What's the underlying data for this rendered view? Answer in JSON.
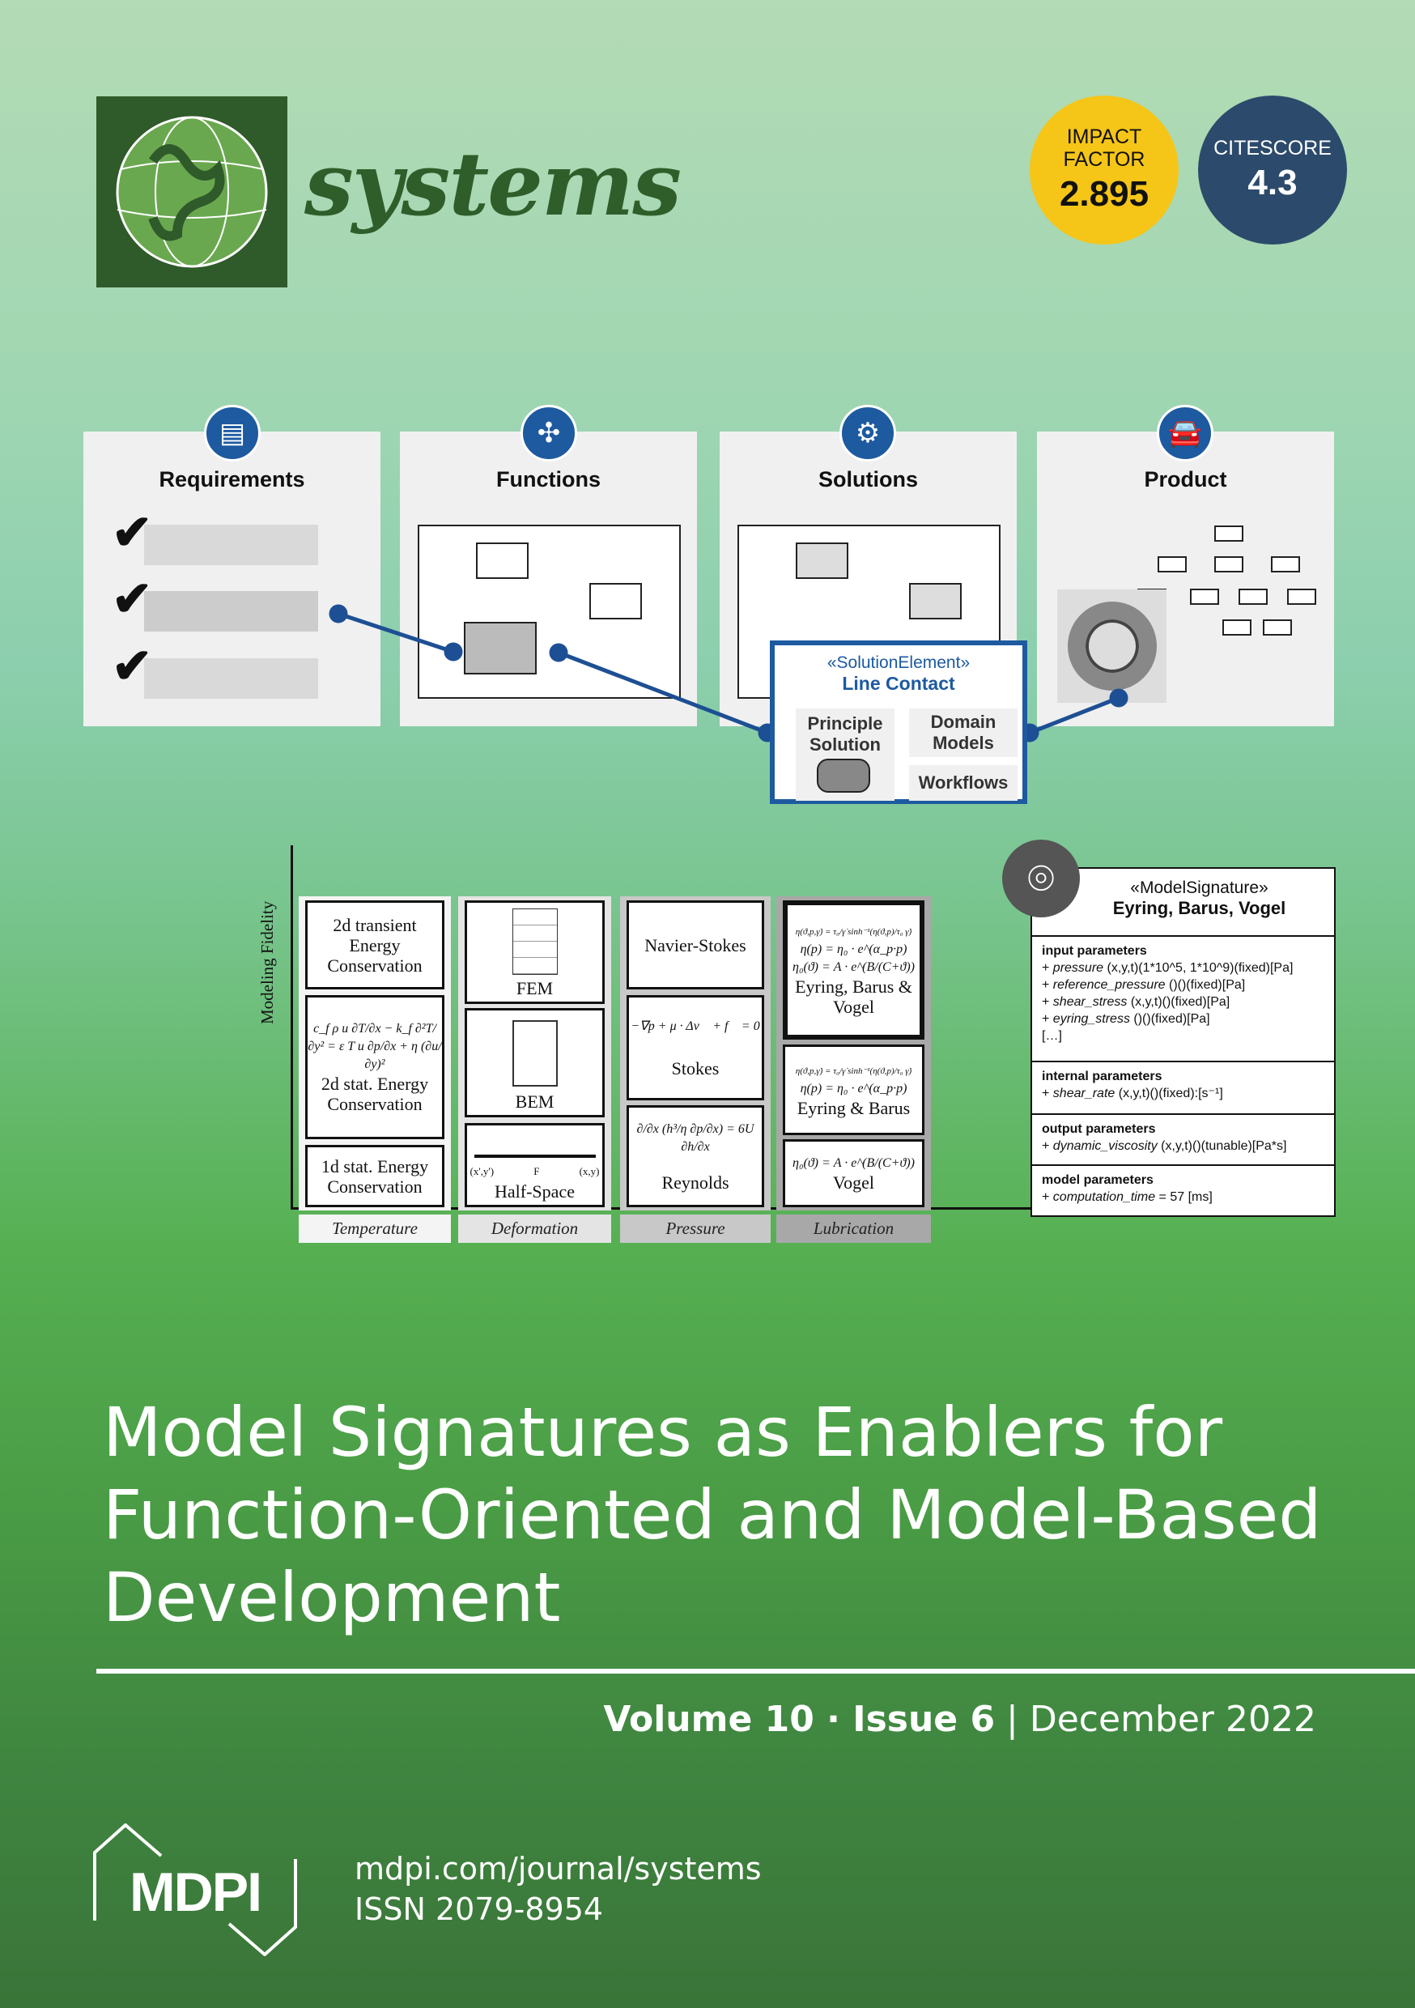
{
  "journal": {
    "name": "systems",
    "logo_icon": "globe-icon"
  },
  "badges": {
    "impact": {
      "label_line1": "IMPACT",
      "label_line2": "FACTOR",
      "value": "2.895",
      "color": "#f5c518"
    },
    "citescore": {
      "label": "CITESCORE",
      "value": "4.3",
      "color": "#2c4a6b"
    }
  },
  "panels": [
    {
      "title": "Requirements",
      "icon": "document-check-icon"
    },
    {
      "title": "Functions",
      "icon": "network-icon"
    },
    {
      "title": "Solutions",
      "icon": "gear-icon"
    },
    {
      "title": "Product",
      "icon": "car-icon"
    }
  ],
  "solution_element": {
    "stereotype": "«SolutionElement»",
    "name": "Line Contact",
    "principle": "Principle Solution",
    "domain_models": "Domain Models",
    "workflows": "Workflows",
    "accent": "#1d5aa0"
  },
  "matrix": {
    "y_axis": "Modeling Fidelity",
    "columns": [
      {
        "label": "Temperature",
        "cells": [
          {
            "text": "2d transient Energy Conservation"
          },
          {
            "eq": "c_f ρ u ∂T/∂x − k_f ∂²T/∂y² = ε T u ∂p/∂x + η (∂u/∂y)²",
            "text": "2d stat. Energy Conservation"
          },
          {
            "text": "1d stat. Energy Conservation"
          }
        ]
      },
      {
        "label": "Deformation",
        "cells": [
          {
            "text": "FEM"
          },
          {
            "text": "BEM"
          },
          {
            "text": "Half-Space",
            "sub1": "(x',y')",
            "sub2": "(x,y)",
            "force": "F"
          }
        ]
      },
      {
        "label": "Pressure",
        "cells": [
          {
            "text": "Navier-Stokes"
          },
          {
            "eq": "−∇p + μ · Δv⃗ + f⃗ = 0",
            "text": "Stokes"
          },
          {
            "eq": "∂/∂x (h³/η ∂p/∂x) = 6U ∂h/∂x",
            "text": "Reynolds"
          }
        ]
      },
      {
        "label": "Lubrication",
        "cells": [
          {
            "eq1": "η(ϑ,p,γ̇) = τ₀/γ̇ sinh⁻¹(η(ϑ,p)/τ₀ γ̇)",
            "eq2": "η(p) = η₀ · e^(α_p·p)",
            "eq3": "η₀(ϑ) = A · e^(B/(C+ϑ))",
            "text": "Eyring, Barus & Vogel"
          },
          {
            "eq1": "η(ϑ,p,γ̇) = τ₀/γ̇ sinh⁻¹(η(ϑ,p)/τ₀ γ̇)",
            "eq2": "η(p) = η₀ · e^(α_p·p)",
            "text": "Eyring & Barus"
          },
          {
            "eq1": "η₀(ϑ) = A · e^(B/(C+ϑ))",
            "text": "Vogel"
          }
        ]
      }
    ]
  },
  "model_signature": {
    "icon": "fingerprint-icon",
    "stereotype": "«ModelSignature»",
    "name": "Eyring, Barus, Vogel",
    "sections": [
      {
        "title": "input parameters",
        "items": [
          {
            "name": "pressure",
            "rest": " (x,y,t)(1*10^5, 1*10^9)(fixed)[Pa]"
          },
          {
            "name": "reference_pressure",
            "rest": " ()()(fixed)[Pa]"
          },
          {
            "name": "shear_stress",
            "rest": " (x,y,t)()(fixed)[Pa]"
          },
          {
            "name": "eyring_stress",
            "rest": " ()()(fixed)[Pa]"
          }
        ],
        "more": "[…]"
      },
      {
        "title": "internal parameters",
        "items": [
          {
            "name": "shear_rate",
            "rest": " (x,y,t)()(fixed):[s⁻¹]"
          }
        ]
      },
      {
        "title": "output parameters",
        "items": [
          {
            "name": "dynamic_viscosity",
            "rest": " (x,y,t)()(tunable)[Pa*s]"
          }
        ]
      },
      {
        "title": "model parameters",
        "items": [
          {
            "name": "computation_time",
            "rest": " = 57 [ms]"
          }
        ]
      }
    ]
  },
  "article_title": {
    "line1": "Model Signatures as Enablers for",
    "line2": "Function-Oriented and Model-Based",
    "line3": "Development"
  },
  "issue": {
    "volume": "Volume 10",
    "sep": " · ",
    "issue": "Issue 6",
    "divider": " | ",
    "date": "December 2022"
  },
  "publisher": {
    "logo": "MDPI",
    "url": "mdpi.com/journal/systems",
    "issn": "ISSN 2079-8954"
  }
}
